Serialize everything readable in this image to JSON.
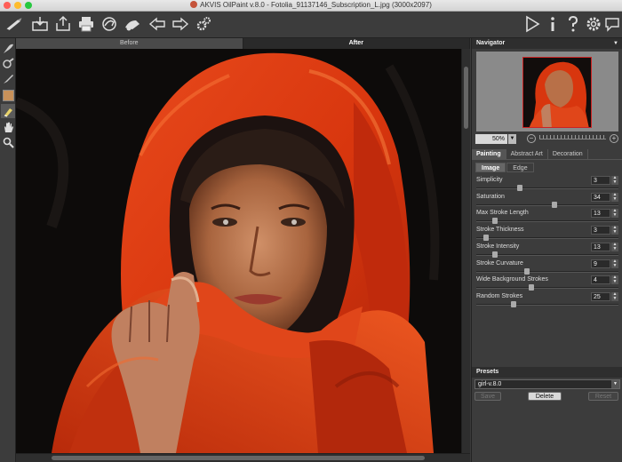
{
  "window": {
    "title": "AKVIS OilPaint v.8.0 - Fotolia_91137146_Subscription_L.jpg (3000x2097)",
    "lights": [
      "#ff5f57",
      "#febc2e",
      "#28c840"
    ]
  },
  "toolbar": {
    "left_icons": [
      "brush-logo-icon",
      "open-icon",
      "save-icon",
      "print-icon",
      "share-icon",
      "batch-icon",
      "back-arrow-icon",
      "forward-arrow-icon",
      "settings-gears-icon"
    ],
    "right_icons": [
      "run-icon",
      "info-icon",
      "help-icon",
      "preferences-icon",
      "hint-icon"
    ]
  },
  "left_tools": [
    "hair-brush-icon",
    "tube-icon",
    "paintbrush-icon",
    "color-swatch",
    "eraser-icon",
    "hand-icon",
    "zoom-icon"
  ],
  "view_tabs": {
    "before": "Before",
    "after": "After"
  },
  "navigator": {
    "title": "Navigator",
    "zoom": "50%"
  },
  "panel_tabs": [
    "Painting",
    "Abstract Art",
    "Decoration"
  ],
  "sub_tabs": [
    "Image",
    "Edge"
  ],
  "params": [
    {
      "label": "Simplicity",
      "value": "3",
      "level": 0.3
    },
    {
      "label": "Saturation",
      "value": "34",
      "level": 0.55
    },
    {
      "label": "Max Stroke Length",
      "value": "13",
      "level": 0.12
    },
    {
      "label": "Stroke Thickness",
      "value": "3",
      "level": 0.05
    },
    {
      "label": "Stroke Intensity",
      "value": "13",
      "level": 0.12
    },
    {
      "label": "Stroke Curvature",
      "value": "9",
      "level": 0.35
    },
    {
      "label": "Wide Background Strokes",
      "value": "4",
      "level": 0.38
    },
    {
      "label": "Random Strokes",
      "value": "25",
      "level": 0.25
    }
  ],
  "presets": {
    "title": "Presets",
    "selected": "girl-v.8.0",
    "save": "Save",
    "delete": "Delete",
    "reset": "Reset"
  }
}
